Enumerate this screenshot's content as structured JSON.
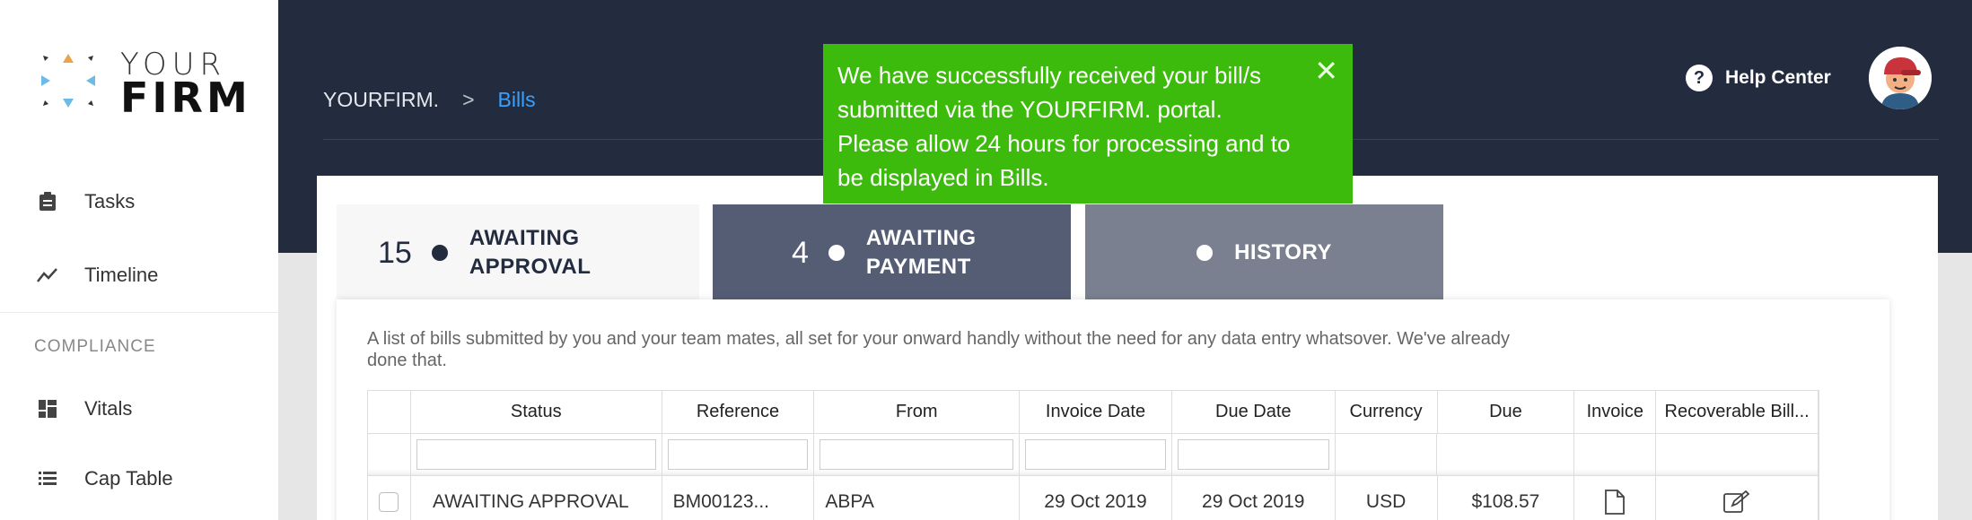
{
  "sidebar": {
    "logo": {
      "line1": "YOUR",
      "line2": "FIRM"
    },
    "items": [
      {
        "label": "Tasks",
        "icon": "clipboard-icon"
      },
      {
        "label": "Timeline",
        "icon": "trend-line-icon"
      }
    ],
    "section": "COMPLIANCE",
    "section_items": [
      {
        "label": "Vitals",
        "icon": "dashboard-grid-icon"
      },
      {
        "label": "Cap Table",
        "icon": "list-icon"
      }
    ]
  },
  "header": {
    "breadcrumb": {
      "root": "YOURFIRM.",
      "separator": ">",
      "current": "Bills"
    },
    "help": {
      "label": "Help Center",
      "icon_glyph": "?"
    }
  },
  "toast": {
    "message": "We have successfully received your bill/s submitted via the YOURFIRM. portal. Please allow 24 hours for processing and to be displayed in Bills.",
    "close_glyph": "✕",
    "color": "#3dbb0c"
  },
  "tabs": [
    {
      "count": "15",
      "label": "AWAITING\nAPPROVAL"
    },
    {
      "count": "4",
      "label": "AWAITING\nPAYMENT"
    },
    {
      "count": "",
      "label": "HISTORY"
    }
  ],
  "description": "A list of bills submitted by you and your team mates, all set for your onward handly without the need for any data entry whatsover. We've already done that.",
  "table": {
    "headers": [
      "",
      "Status",
      "Reference",
      "From",
      "Invoice Date",
      "Due Date",
      "Currency",
      "Due",
      "Invoice",
      "Recoverable Bill..."
    ],
    "rows": [
      {
        "status": "AWAITING APPROVAL",
        "reference": "BM00123...",
        "from": "ABPA",
        "invoice_date": "29 Oct 2019",
        "due_date": "29 Oct 2019",
        "currency": "USD",
        "due": "$108.57"
      }
    ]
  },
  "colors": {
    "navy": "#232c3e",
    "accent_link": "#3aa0ff",
    "tab_payment": "#555d74",
    "tab_history": "#7a8090"
  }
}
